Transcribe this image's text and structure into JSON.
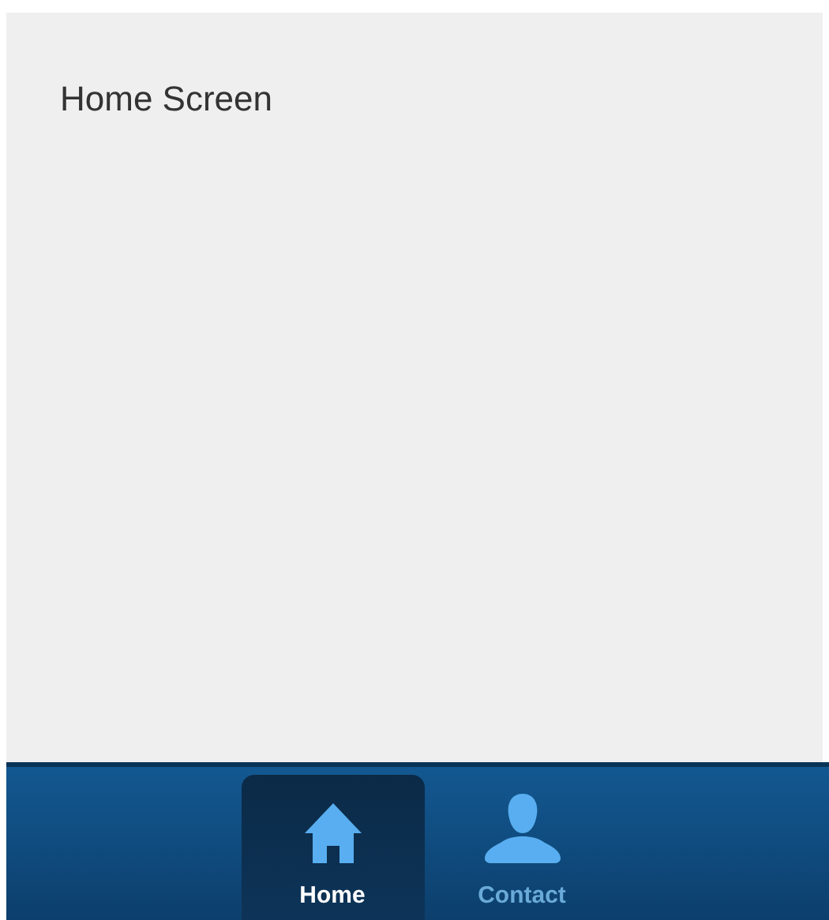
{
  "content": {
    "title": "Home Screen"
  },
  "tabs": [
    {
      "label": "Home",
      "kind": "house",
      "selected": true
    },
    {
      "label": "Contact",
      "kind": "person",
      "selected": false
    }
  ]
}
